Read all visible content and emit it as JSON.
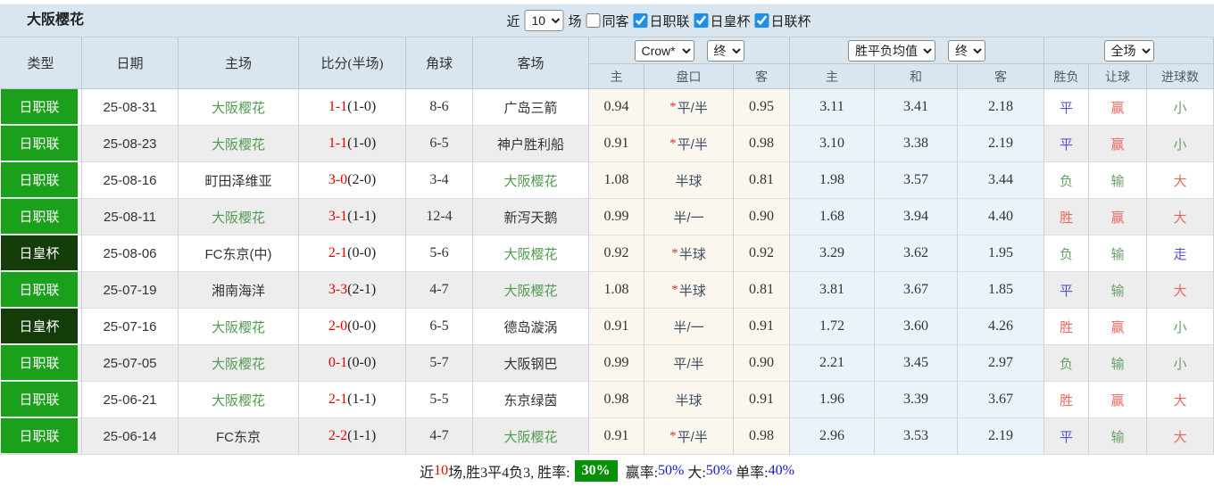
{
  "title": "大阪樱花",
  "topbar": {
    "near_label": "近",
    "near_value": "10",
    "matches_label": "场",
    "same_away_label": "同客",
    "leagues": [
      {
        "label": "日职联",
        "checked": true
      },
      {
        "label": "日皇杯",
        "checked": true
      },
      {
        "label": "日联杯",
        "checked": true
      }
    ]
  },
  "header": {
    "cols": [
      "类型",
      "日期",
      "主场",
      "比分(半场)",
      "角球",
      "客场"
    ],
    "odds_company": "Crow*",
    "odds_time": "终",
    "europe_odds": "胜平负均值",
    "europe_time": "终",
    "scope": "全场",
    "sub": [
      "主",
      "盘口",
      "客",
      "主",
      "和",
      "客",
      "胜负",
      "让球",
      "进球数"
    ]
  },
  "rows": [
    {
      "league": "日职联",
      "league_type": "j1",
      "date": "25-08-31",
      "home": "大阪樱花",
      "home_green": true,
      "score": "1-1",
      "half": "(1-0)",
      "corner": "8-6",
      "away": "广岛三箭",
      "away_green": false,
      "ah_home": "0.94",
      "handicap_star": true,
      "handicap": "平/半",
      "ah_away": "0.95",
      "eu_home": "3.11",
      "eu_draw": "3.41",
      "eu_away": "2.18",
      "result": {
        "text": "平",
        "color": "blue"
      },
      "let_result": {
        "text": "赢",
        "color": "red"
      },
      "goals": {
        "text": "小",
        "color": "green"
      }
    },
    {
      "league": "日职联",
      "league_type": "j1",
      "date": "25-08-23",
      "home": "大阪樱花",
      "home_green": true,
      "score": "1-1",
      "half": "(1-0)",
      "corner": "6-5",
      "away": "神户胜利船",
      "away_green": false,
      "ah_home": "0.91",
      "handicap_star": true,
      "handicap": "平/半",
      "ah_away": "0.98",
      "eu_home": "3.10",
      "eu_draw": "3.38",
      "eu_away": "2.19",
      "result": {
        "text": "平",
        "color": "blue"
      },
      "let_result": {
        "text": "赢",
        "color": "red"
      },
      "goals": {
        "text": "小",
        "color": "green"
      }
    },
    {
      "league": "日职联",
      "league_type": "j1",
      "date": "25-08-16",
      "home": "町田泽维亚",
      "home_green": false,
      "score": "3-0",
      "half": "(2-0)",
      "corner": "3-4",
      "away": "大阪樱花",
      "away_green": true,
      "ah_home": "1.08",
      "handicap_star": false,
      "handicap": "半球",
      "ah_away": "0.81",
      "eu_home": "1.98",
      "eu_draw": "3.57",
      "eu_away": "3.44",
      "result": {
        "text": "负",
        "color": "green"
      },
      "let_result": {
        "text": "输",
        "color": "green"
      },
      "goals": {
        "text": "大",
        "color": "red"
      }
    },
    {
      "league": "日职联",
      "league_type": "j1",
      "date": "25-08-11",
      "home": "大阪樱花",
      "home_green": true,
      "score": "3-1",
      "half": "(1-1)",
      "corner": "12-4",
      "away": "新泻天鹅",
      "away_green": false,
      "ah_home": "0.99",
      "handicap_star": false,
      "handicap": "半/一",
      "ah_away": "0.90",
      "eu_home": "1.68",
      "eu_draw": "3.94",
      "eu_away": "4.40",
      "result": {
        "text": "胜",
        "color": "red"
      },
      "let_result": {
        "text": "赢",
        "color": "red"
      },
      "goals": {
        "text": "大",
        "color": "red"
      }
    },
    {
      "league": "日皇杯",
      "league_type": "cup",
      "date": "25-08-06",
      "home": "FC东京(中)",
      "home_green": false,
      "score": "2-1",
      "half": "(0-0)",
      "corner": "5-6",
      "away": "大阪樱花",
      "away_green": true,
      "ah_home": "0.92",
      "handicap_star": true,
      "handicap": "半球",
      "ah_away": "0.92",
      "eu_home": "3.29",
      "eu_draw": "3.62",
      "eu_away": "1.95",
      "result": {
        "text": "负",
        "color": "green"
      },
      "let_result": {
        "text": "输",
        "color": "green"
      },
      "goals": {
        "text": "走",
        "color": "blue"
      }
    },
    {
      "league": "日职联",
      "league_type": "j1",
      "date": "25-07-19",
      "home": "湘南海洋",
      "home_green": false,
      "score": "3-3",
      "half": "(2-1)",
      "corner": "4-7",
      "away": "大阪樱花",
      "away_green": true,
      "ah_home": "1.08",
      "handicap_star": true,
      "handicap": "半球",
      "ah_away": "0.81",
      "eu_home": "3.81",
      "eu_draw": "3.67",
      "eu_away": "1.85",
      "result": {
        "text": "平",
        "color": "blue"
      },
      "let_result": {
        "text": "输",
        "color": "green"
      },
      "goals": {
        "text": "大",
        "color": "red"
      }
    },
    {
      "league": "日皇杯",
      "league_type": "cup",
      "date": "25-07-16",
      "home": "大阪樱花",
      "home_green": true,
      "score": "2-0",
      "half": "(0-0)",
      "corner": "6-5",
      "away": "德岛漩涡",
      "away_green": false,
      "ah_home": "0.91",
      "handicap_star": false,
      "handicap": "半/一",
      "ah_away": "0.91",
      "eu_home": "1.72",
      "eu_draw": "3.60",
      "eu_away": "4.26",
      "result": {
        "text": "胜",
        "color": "red"
      },
      "let_result": {
        "text": "赢",
        "color": "red"
      },
      "goals": {
        "text": "小",
        "color": "green"
      }
    },
    {
      "league": "日职联",
      "league_type": "j1",
      "date": "25-07-05",
      "home": "大阪樱花",
      "home_green": true,
      "score": "0-1",
      "half": "(0-0)",
      "corner": "5-7",
      "away": "大阪钢巴",
      "away_green": false,
      "ah_home": "0.99",
      "handicap_star": false,
      "handicap": "平/半",
      "ah_away": "0.90",
      "eu_home": "2.21",
      "eu_draw": "3.45",
      "eu_away": "2.97",
      "result": {
        "text": "负",
        "color": "green"
      },
      "let_result": {
        "text": "输",
        "color": "green"
      },
      "goals": {
        "text": "小",
        "color": "green"
      }
    },
    {
      "league": "日职联",
      "league_type": "j1",
      "date": "25-06-21",
      "home": "大阪樱花",
      "home_green": true,
      "score": "2-1",
      "half": "(1-1)",
      "corner": "5-5",
      "away": "东京绿茵",
      "away_green": false,
      "ah_home": "0.98",
      "handicap_star": false,
      "handicap": "半球",
      "ah_away": "0.91",
      "eu_home": "1.96",
      "eu_draw": "3.39",
      "eu_away": "3.67",
      "result": {
        "text": "胜",
        "color": "red"
      },
      "let_result": {
        "text": "赢",
        "color": "red"
      },
      "goals": {
        "text": "大",
        "color": "red"
      }
    },
    {
      "league": "日职联",
      "league_type": "j1",
      "date": "25-06-14",
      "home": "FC东京",
      "home_green": false,
      "score": "2-2",
      "half": "(1-1)",
      "corner": "4-7",
      "away": "大阪樱花",
      "away_green": true,
      "ah_home": "0.91",
      "handicap_star": true,
      "handicap": "平/半",
      "ah_away": "0.98",
      "eu_home": "2.96",
      "eu_draw": "3.53",
      "eu_away": "2.19",
      "result": {
        "text": "平",
        "color": "blue"
      },
      "let_result": {
        "text": "输",
        "color": "green"
      },
      "goals": {
        "text": "大",
        "color": "red"
      }
    }
  ],
  "footer": {
    "near": "近",
    "count": "10",
    "summary": "场,胜3平4负3, 胜率:",
    "win_rate": "30%",
    "win_label": " 赢率:",
    "win_pct": "50%",
    "big_label": " 大:",
    "big_pct": "50%",
    "single_label": " 单率:",
    "single_pct": "40%"
  },
  "colors": {
    "league_green": "#1aa01a",
    "cup_dark_green": "#143c08",
    "team_green": "#529a52",
    "score_red": "#e80000",
    "result_red": "#e5685e",
    "result_green": "#68a068",
    "result_blue": "#5552d5",
    "badge_green": "#089008",
    "pct_blue": "#1515d8",
    "header_bg": "#d9e5ef",
    "asian_odds_bg": "#fcf7ee",
    "europe_odds_bg": "#eaf3f9"
  }
}
